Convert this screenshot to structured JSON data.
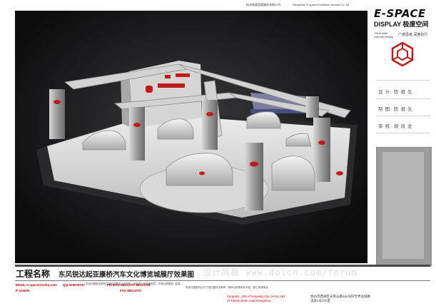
{
  "header": {
    "company_cn": "杭州易度会展服务有限公司",
    "company_en": "Hangzhou E-space Exhibition service Co.,ltd"
  },
  "logo": {
    "brand": "E-SPACE",
    "sub": "DISPLAY 极度空间",
    "slogan_en_1": "Think wide",
    "slogan_en_2": "execute deeply",
    "slogan_cn": "广度思考,深度执行"
  },
  "sidebar": {
    "design": "设 计: 陈 君 生",
    "drawing": "制 图: 陈 君 生",
    "review": "审 核: 胡 效 龙"
  },
  "project": {
    "label": "工程名称",
    "name": "东风锐达起亚康桥汽车文化博览城展厅效果图"
  },
  "contact": {
    "email": "EMAIL:e-space@sohu.com",
    "qq": "QQ:329978747",
    "p": "P:310000",
    "ph": "PH:0571-88213707  88213709",
    "fax": "FAX:88213707",
    "addr_en_1": "Yuquan1, 102 of longxing City on No.162",
    "addr_en_2": "of Tianmushan road,Hangzhou",
    "addr_cn_1": "杭州市西湖区天目山路162号好世界龙城路",
    "addr_cn_2": "玉泉1号102室"
  },
  "notes": {
    "n1": "本设计图纸及说明之版权均属本公司所有，未经本公司书面同意，不得对其使用 / 复制。",
    "n2": "本设计图纸所示尺寸及位置仅供参考，具体以现场实际为准，施工前请核对。"
  },
  "watermark": "设计风暴  www.dolcn.com/forum",
  "colors": {
    "accent_red": "#c00000",
    "kia_red": "#c21a1a",
    "render_bg": "#0c0c0d"
  }
}
